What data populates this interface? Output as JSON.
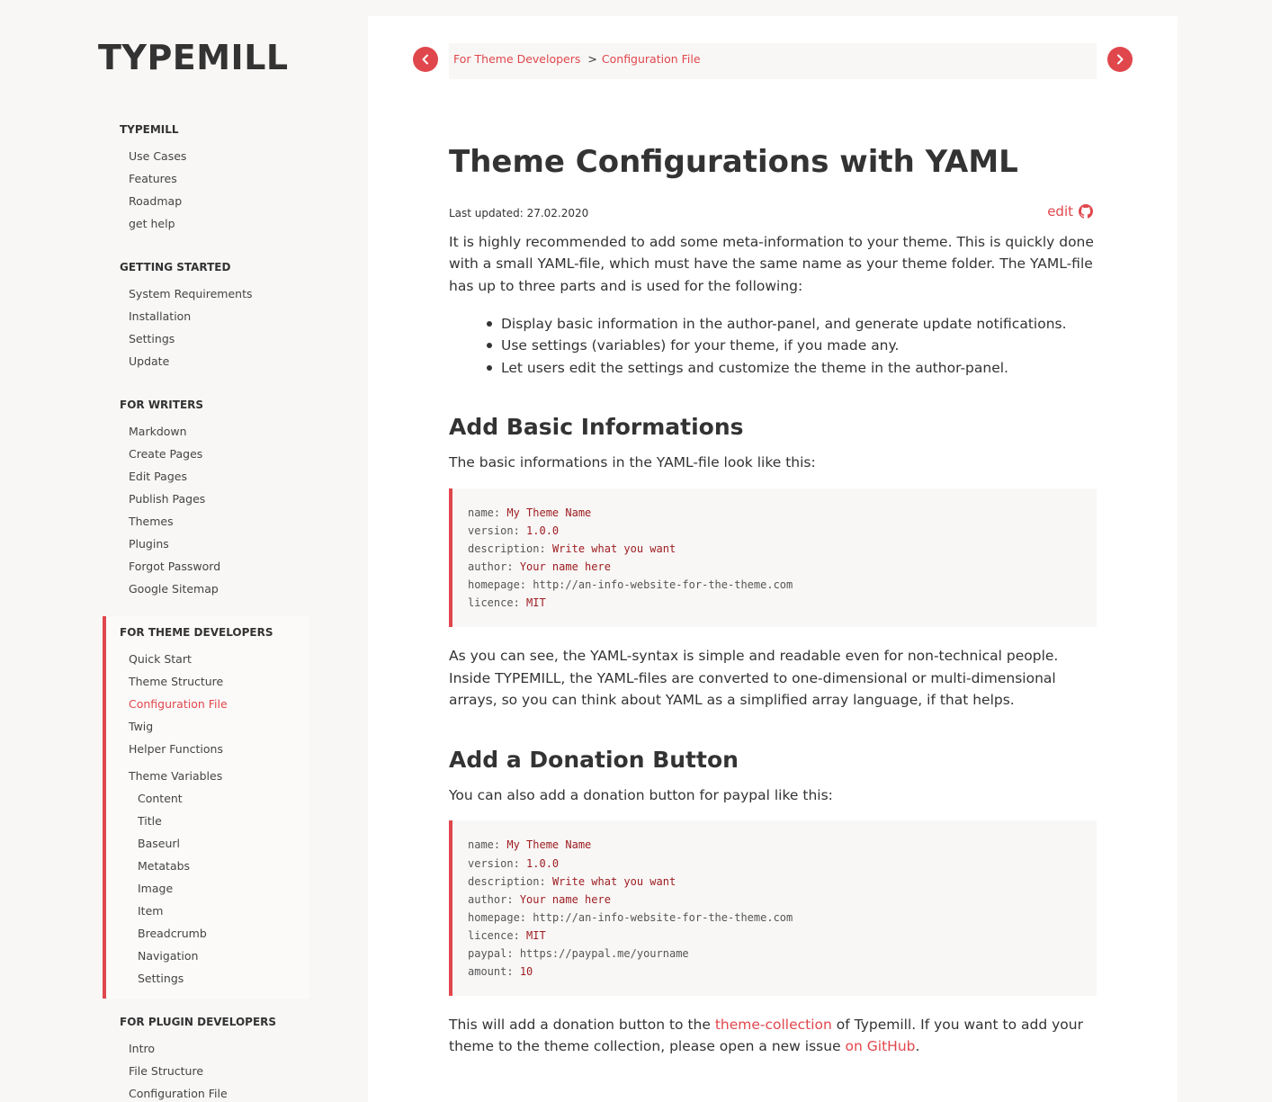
{
  "app": {
    "logo": "TYPEMILL"
  },
  "sidebar": {
    "sections": [
      {
        "head": "TYPEMILL",
        "items": [
          "Use Cases",
          "Features",
          "Roadmap",
          "get help"
        ]
      },
      {
        "head": "GETTING STARTED",
        "items": [
          "System Requirements",
          "Installation",
          "Settings",
          "Update"
        ]
      },
      {
        "head": "FOR WRITERS",
        "items": [
          "Markdown",
          "Create Pages",
          "Edit Pages",
          "Publish Pages",
          "Themes",
          "Plugins",
          "Forgot Password",
          "Google Sitemap"
        ]
      },
      {
        "head": "FOR THEME DEVELOPERS",
        "items": [
          "Quick Start",
          "Theme Structure",
          "Configuration File",
          "Twig",
          "Helper Functions",
          "Theme Variables"
        ],
        "subitems": [
          "Content",
          "Title",
          "Baseurl",
          "Metatabs",
          "Image",
          "Item",
          "Breadcrumb",
          "Navigation",
          "Settings"
        ]
      },
      {
        "head": "FOR PLUGIN DEVELOPERS",
        "items": [
          "Intro",
          "File Structure",
          "Configuration File"
        ]
      }
    ]
  },
  "breadcrumb": {
    "parent": "For Theme Developers",
    "separator": ">",
    "current": "Configuration File"
  },
  "page": {
    "title": "Theme Configurations with YAML",
    "last_updated": "Last updated: 27.02.2020",
    "edit_label": "edit",
    "intro": "It is highly recommended to add some meta-information to your theme. This is quickly done with a small YAML-file, which must have the same name as your theme folder. The YAML-file has up to three parts and is used for the following:",
    "bullets": [
      "Display basic information in the author-panel, and generate update notifications.",
      "Use settings (variables) for your theme, if you made any.",
      "Let users edit the settings and customize the theme in the author-panel."
    ],
    "section1": {
      "heading": "Add Basic Informations",
      "text": "The basic informations in the YAML-file look like this:",
      "code": [
        {
          "key": "name:",
          "val": "My Theme Name",
          "plain": false
        },
        {
          "key": "version:",
          "val": "1.0.0",
          "plain": false
        },
        {
          "key": "description:",
          "val": "Write what you want",
          "plain": false
        },
        {
          "key": "author:",
          "val": "Your name here",
          "plain": false
        },
        {
          "key": "homepage:",
          "val": "http://an-info-website-for-the-theme.com",
          "plain": true
        },
        {
          "key": "licence:",
          "val": "MIT",
          "plain": false
        }
      ],
      "after": "As you can see, the YAML-syntax is simple and readable even for non-technical people. Inside TYPEMILL, the YAML-files are converted to one-dimensional or multi-dimensional arrays, so you can think about YAML as a simplified array language, if that helps."
    },
    "section2": {
      "heading": "Add a Donation Button",
      "text": "You can also add a donation button for paypal like this:",
      "code": [
        {
          "key": "name:",
          "val": "My Theme Name",
          "plain": false
        },
        {
          "key": "version:",
          "val": "1.0.0",
          "plain": false
        },
        {
          "key": "description:",
          "val": "Write what you want",
          "plain": false
        },
        {
          "key": "author:",
          "val": "Your name here",
          "plain": false
        },
        {
          "key": "homepage:",
          "val": "http://an-info-website-for-the-theme.com",
          "plain": true
        },
        {
          "key": "licence:",
          "val": "MIT",
          "plain": false
        },
        {
          "key": "paypal:",
          "val": "https://paypal.me/yourname",
          "plain": true
        },
        {
          "key": "amount:",
          "val": "10",
          "plain": false
        }
      ],
      "after_parts": {
        "t1": "This will add a donation button to the ",
        "link1": "theme-collection",
        "t2": " of Typemill. If you want to add your theme to the theme collection, please open a new issue ",
        "link2": "on GitHub",
        "t3": "."
      }
    }
  },
  "colors": {
    "accent": "#e0474c",
    "code_value": "#9d1b1f",
    "page_bg": "#f8f7f6"
  },
  "icons": {
    "prev": "chevron-left-icon",
    "next": "chevron-right-icon",
    "edit": "github-icon"
  }
}
